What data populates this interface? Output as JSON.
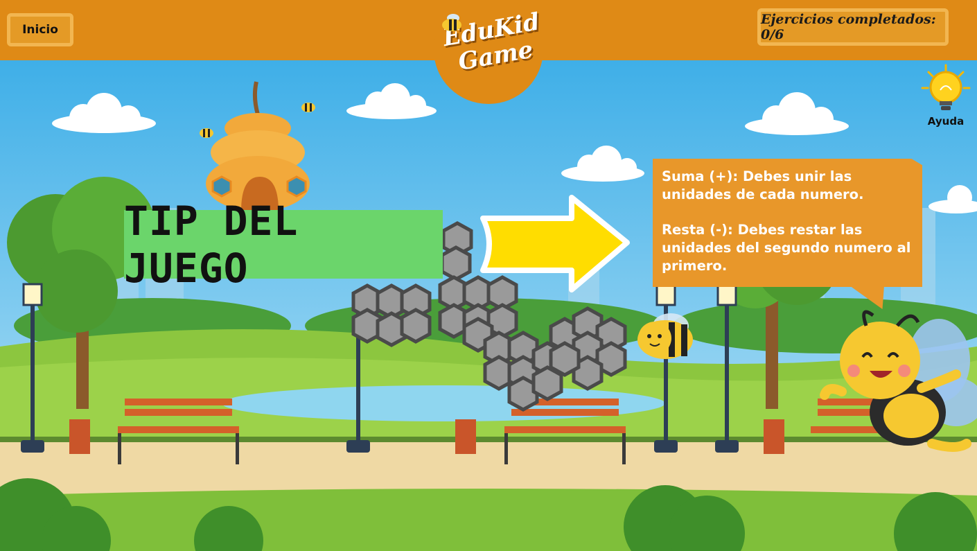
{
  "header": {
    "home_button_label": "Inicio",
    "exercises_counter": "Ejercicios completados: 0/6",
    "logo_line1": "EduKid",
    "logo_line2": "Game"
  },
  "help": {
    "label": "Ayuda",
    "icon": "lightbulb-icon"
  },
  "tip": {
    "banner_text": "TIP DEL JUEGO",
    "lines": [
      "Suma (+): Debes unir las unidades de cada numero.",
      "Resta (-): Debes restar las unidades del segundo numero al primero."
    ]
  },
  "colors": {
    "topbar": "#df8a16",
    "button_fill": "#e49a26",
    "button_border": "#f2b651",
    "tip_banner": "#6bd56b",
    "bubble": "#e8972a",
    "arrow": "#ffdd00",
    "honeycomb": "#9a9a9a"
  }
}
